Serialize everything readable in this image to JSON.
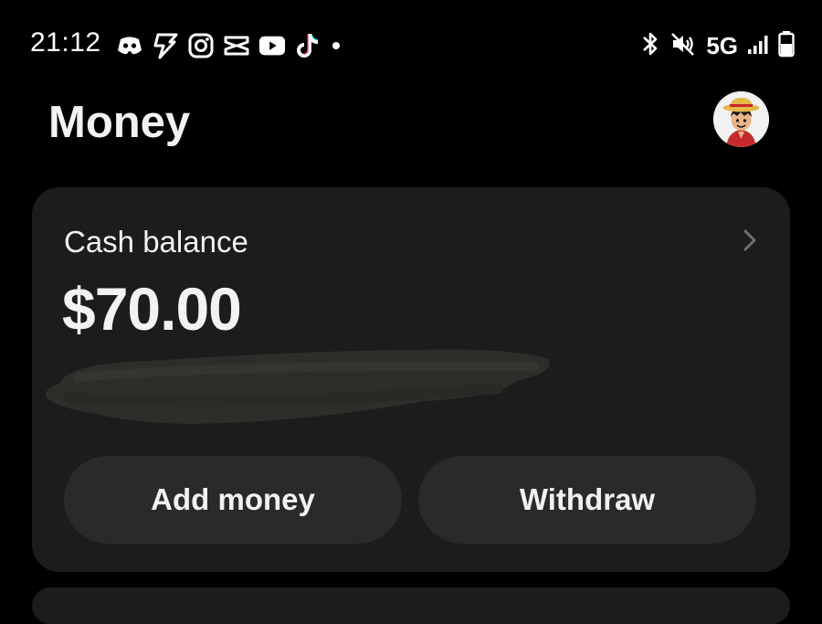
{
  "status_bar": {
    "time": "21:12",
    "left_icons": [
      "discord-icon",
      "bolt-icon",
      "instagram-icon",
      "capcut-icon",
      "youtube-icon",
      "tiktok-icon",
      "dot-icon"
    ],
    "right_icons": [
      "bluetooth-icon",
      "muted-icon",
      "signal-icon",
      "battery-icon"
    ],
    "network": "5G"
  },
  "header": {
    "title": "Money"
  },
  "balance_card": {
    "label": "Cash balance",
    "amount": "$70.00"
  },
  "actions": {
    "add_money": "Add money",
    "withdraw": "Withdraw"
  },
  "colors": {
    "background": "#000000",
    "card": "#1c1c1c",
    "button": "#2a2a2a",
    "text": "#f2f2f2"
  }
}
